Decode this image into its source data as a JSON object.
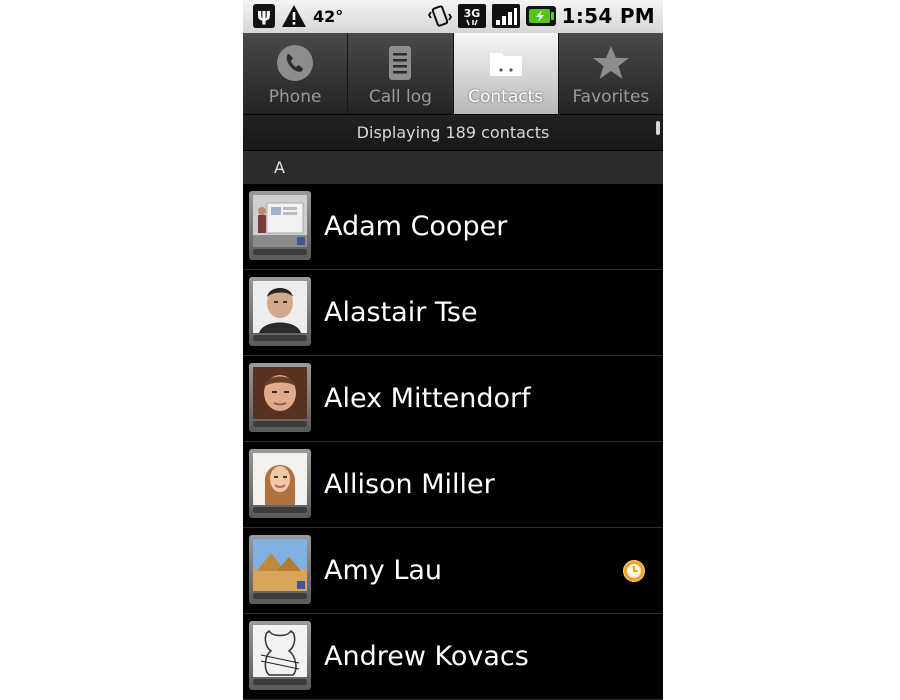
{
  "status_bar": {
    "temperature": "42°",
    "network": "3G",
    "time": "1:54 PM"
  },
  "tabs": [
    {
      "label": "Phone",
      "icon": "phone-icon",
      "selected": false
    },
    {
      "label": "Call log",
      "icon": "call-log-icon",
      "selected": false
    },
    {
      "label": "Contacts",
      "icon": "contacts-folder-icon",
      "selected": true
    },
    {
      "label": "Favorites",
      "icon": "star-icon",
      "selected": false
    }
  ],
  "contacts_header": {
    "count_text": "Displaying 189 contacts",
    "section_letter": "A"
  },
  "contacts": [
    {
      "name": "Adam Cooper",
      "avatar": "presentation-photo"
    },
    {
      "name": "Alastair Tse",
      "avatar": "portrait-photo"
    },
    {
      "name": "Alex Mittendorf",
      "avatar": "portrait-photo"
    },
    {
      "name": "Allison Miller",
      "avatar": "portrait-photo"
    },
    {
      "name": "Amy Lau",
      "avatar": "pyramids-photo",
      "presence": "away-clock-icon"
    },
    {
      "name": "Andrew Kovacs",
      "avatar": "artwork-photo"
    }
  ],
  "colors": {
    "background": "#000000",
    "selected_tab": "#e0e0e0",
    "presence_away": "#f4a32a"
  }
}
